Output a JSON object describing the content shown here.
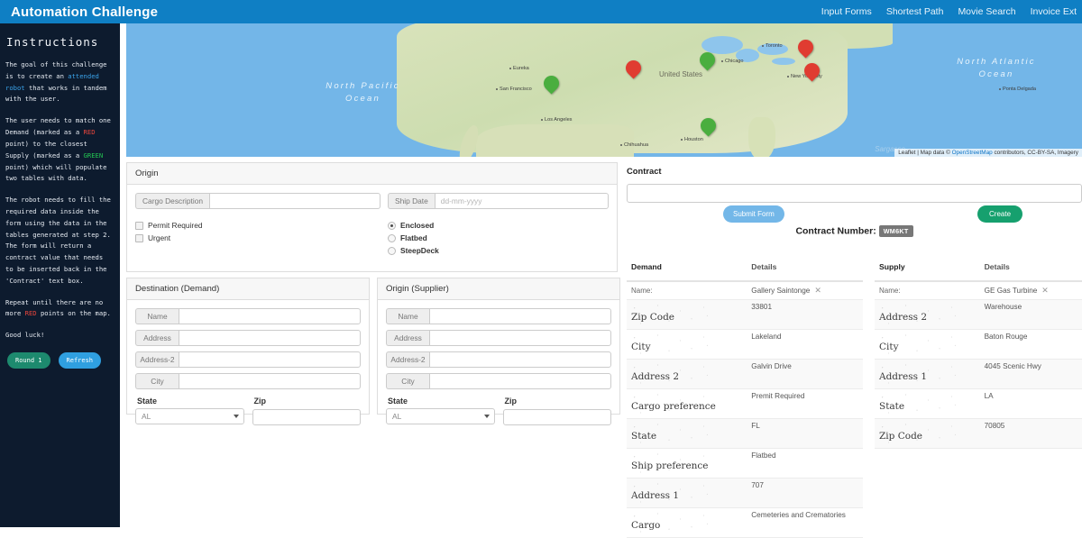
{
  "navbar": {
    "brand": "Automation Challenge",
    "links": [
      {
        "label": "Input Forms"
      },
      {
        "label": "Shortest Path"
      },
      {
        "label": "Movie Search"
      },
      {
        "label": "Invoice Ext"
      }
    ]
  },
  "sidebar": {
    "title": "Instructions",
    "p1_a": "The goal of this challenge is to create an ",
    "p1_hl": "attended robot",
    "p1_b": " that works in tandem with the user.",
    "p2_a": "The user needs to match one Demand (marked as a ",
    "p2_red": "RED",
    "p2_b": " point) to the closest Supply (marked as a ",
    "p2_green": "GREEN",
    "p2_c": " point) which will populate two tables with data.",
    "p3": "The robot needs to fill the required data inside the form using the data in the tables generated at step 2. The form will return a contract value that needs to be inserted back in the 'Contract' text box.",
    "p4_a": "Repeat until there are no more ",
    "p4_red": "RED",
    "p4_b": " points on the map.",
    "p5": "Good luck!",
    "round_button": "Round 1",
    "refresh_button": "Refresh"
  },
  "map": {
    "ocean_pacific": "North Pacific Ocean",
    "ocean_atlantic": "North Atlantic Ocean",
    "country": "United States",
    "cities": [
      {
        "name": "Eureka"
      },
      {
        "name": "San Francisco"
      },
      {
        "name": "Los Angeles"
      },
      {
        "name": "Chihuahua"
      },
      {
        "name": "Houston"
      },
      {
        "name": "Chicago"
      },
      {
        "name": "Toronto"
      },
      {
        "name": "New York City"
      },
      {
        "name": "Ponta Delgada"
      }
    ],
    "watermark": "Sargasso",
    "attribution_prefix": "Leaflet | Map data © ",
    "attribution_link": "OpenStreetMap",
    "attribution_suffix": " contributors, CC-BY-SA, Imagery",
    "markers": [
      {
        "type": "demand",
        "color": "#e03c31"
      },
      {
        "type": "demand",
        "color": "#e03c31"
      },
      {
        "type": "demand",
        "color": "#e03c31"
      },
      {
        "type": "supply",
        "color": "#4aae3f"
      },
      {
        "type": "supply",
        "color": "#4aae3f"
      },
      {
        "type": "supply",
        "color": "#4aae3f"
      }
    ]
  },
  "origin_form": {
    "title": "Origin",
    "cargo_description_label": "Cargo Description",
    "cargo_description_value": "",
    "ship_date_label": "Ship Date",
    "ship_date_placeholder": "dd-mm-yyyy",
    "ship_date_value": "",
    "checkboxes": [
      {
        "label": "Permit Required",
        "checked": false
      },
      {
        "label": "Urgent",
        "checked": false
      }
    ],
    "radios": [
      {
        "label": "Enclosed",
        "checked": true
      },
      {
        "label": "Flatbed",
        "checked": false
      },
      {
        "label": "SteepDeck",
        "checked": false
      }
    ]
  },
  "destination_form": {
    "title": "Destination (Demand)",
    "fields": [
      {
        "label": "Name",
        "value": ""
      },
      {
        "label": "Address",
        "value": ""
      },
      {
        "label": "Address-2",
        "value": ""
      },
      {
        "label": "City",
        "value": ""
      }
    ],
    "state_label": "State",
    "state_value": "AL",
    "zip_label": "Zip",
    "zip_value": ""
  },
  "supplier_form": {
    "title": "Origin (Supplier)",
    "fields": [
      {
        "label": "Name",
        "value": ""
      },
      {
        "label": "Address",
        "value": ""
      },
      {
        "label": "Address-2",
        "value": ""
      },
      {
        "label": "City",
        "value": ""
      }
    ],
    "state_label": "State",
    "state_value": "AL",
    "zip_label": "Zip",
    "zip_value": ""
  },
  "contract": {
    "label": "Contract",
    "value": "",
    "submit_button": "Submit Form",
    "create_button": "Create",
    "number_label": "Contract Number:",
    "number_value": "WM6KT"
  },
  "demand_table": {
    "header_key": "Demand",
    "header_value": "Details",
    "name_key": "Name:",
    "name_value": "Gallery Saintonge",
    "rows": [
      {
        "key": "Zip Code",
        "value": "33801"
      },
      {
        "key": "City",
        "value": "Lakeland"
      },
      {
        "key": "Address 2",
        "value": "Galvin Drive"
      },
      {
        "key": "Cargo preference",
        "value": "Premit Required"
      },
      {
        "key": "State",
        "value": "FL"
      },
      {
        "key": "Ship preference",
        "value": "Flatbed"
      },
      {
        "key": "Address 1",
        "value": "707"
      },
      {
        "key": "Cargo",
        "value": "Cemeteries and Crematories"
      }
    ]
  },
  "supply_table": {
    "header_key": "Supply",
    "header_value": "Details",
    "name_key": "Name:",
    "name_value": "GE Gas Turbine",
    "rows": [
      {
        "key": "Address 2",
        "value": "Warehouse"
      },
      {
        "key": "City",
        "value": "Baton Rouge"
      },
      {
        "key": "Address 1",
        "value": "4045 Scenic Hwy"
      },
      {
        "key": "State",
        "value": "LA"
      },
      {
        "key": "Zip Code",
        "value": "70805"
      }
    ]
  }
}
